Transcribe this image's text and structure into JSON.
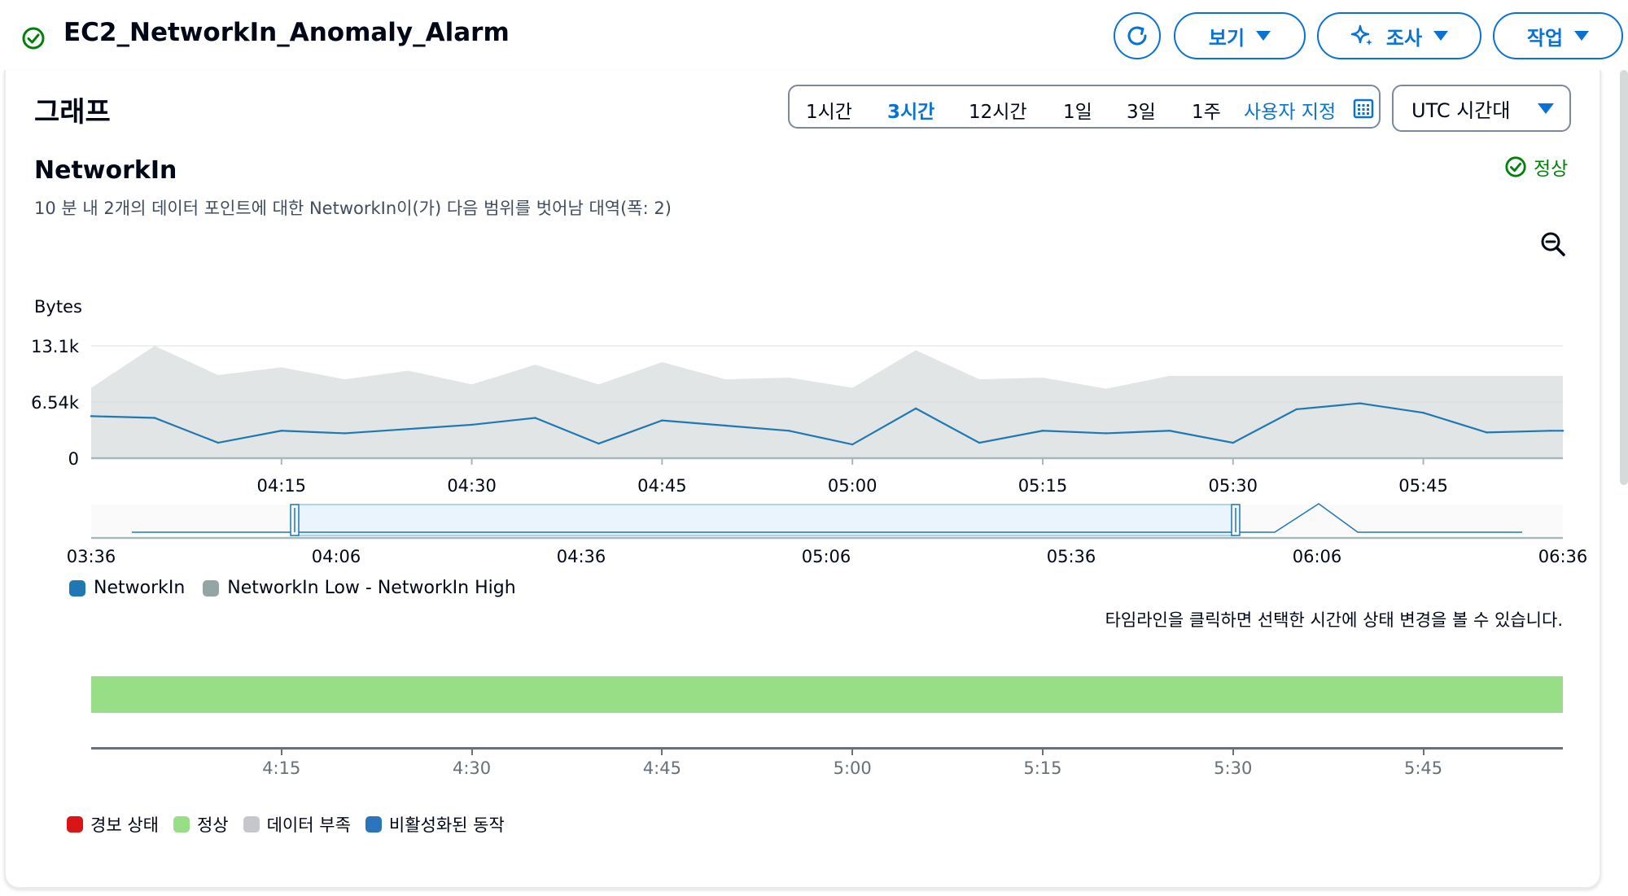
{
  "header": {
    "title": "EC2_NetworkIn_Anomaly_Alarm",
    "view_label": "보기",
    "investigate_label": "조사",
    "actions_label": "작업"
  },
  "graph": {
    "title": "그래프",
    "time_ranges": [
      "1시간",
      "3시간",
      "12시간",
      "1일",
      "3일",
      "1주"
    ],
    "active_range": "3시간",
    "custom_label": "사용자 지정",
    "timezone": "UTC 시간대"
  },
  "metric": {
    "name": "NetworkIn",
    "description": "10 분 내 2개의 데이터 포인트에 대한 NetworkIn이(가) 다음 범위를 벗어남 대역(폭: 2)",
    "state": "정상"
  },
  "chart_data": {
    "type": "line",
    "ylabel": "Bytes",
    "y_ticks": [
      "13.1k",
      "6.54k",
      "0"
    ],
    "ylim": [
      0,
      13100
    ],
    "x_ticks": [
      "04:15",
      "04:30",
      "04:45",
      "05:00",
      "05:15",
      "05:30",
      "05:45"
    ],
    "x_minutes": [
      0,
      5,
      10,
      15,
      20,
      25,
      30,
      35,
      40,
      45,
      50,
      55,
      60,
      65,
      70,
      75,
      80,
      85,
      90,
      95,
      100,
      105,
      110,
      115,
      116
    ],
    "x_start": "04:00",
    "series": [
      {
        "name": "NetworkIn",
        "color": "#1f77b4",
        "values": [
          4900,
          4700,
          1800,
          3200,
          2900,
          3400,
          3900,
          4700,
          1700,
          4400,
          3800,
          3200,
          1600,
          5800,
          1800,
          3200,
          2900,
          3200,
          1800,
          5700,
          6400,
          5300,
          3000,
          3200,
          3200
        ]
      },
      {
        "name": "NetworkIn Low - NetworkIn High",
        "color": "#d5dbdb",
        "low": [
          0,
          0,
          0,
          0,
          0,
          0,
          0,
          0,
          0,
          0,
          0,
          0,
          0,
          0,
          0,
          0,
          0,
          0,
          0,
          0,
          0,
          0,
          0,
          0,
          0
        ],
        "high": [
          8200,
          13100,
          9700,
          10600,
          9200,
          10200,
          8600,
          10900,
          8600,
          11200,
          9200,
          9400,
          8200,
          12600,
          9200,
          9400,
          8100,
          9600,
          9600,
          9600,
          9600,
          9600,
          9600,
          9600,
          9600
        ]
      }
    ],
    "navigator": {
      "x_ticks": [
        "03:36",
        "04:06",
        "04:36",
        "05:06",
        "05:36",
        "06:06",
        "06:36"
      ]
    }
  },
  "timeline": {
    "hint": "타임라인을 클릭하면 선택한 시간에 상태 변경을 볼 수 있습니다.",
    "ticks": [
      "4:15",
      "4:30",
      "4:45",
      "5:00",
      "5:15",
      "5:30",
      "5:45"
    ],
    "state_color": "#98de86",
    "legend": [
      {
        "label": "경보 상태",
        "color": "#d91515"
      },
      {
        "label": "정상",
        "color": "#98de86"
      },
      {
        "label": "데이터 부족",
        "color": "#c6c6cd"
      },
      {
        "label": "비활성화된 동작",
        "color": "#2a75bb"
      }
    ]
  }
}
